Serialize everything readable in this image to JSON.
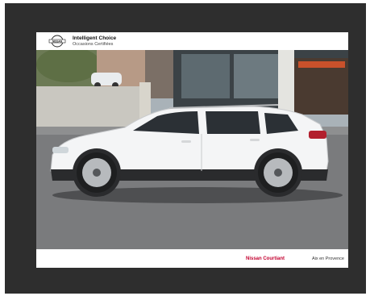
{
  "brand": {
    "logo_text": "NISSAN",
    "title": "Intelligent Choice",
    "subtitle": "Occasions Certifiées"
  },
  "photo": {
    "subject": "white-suv-side-view"
  },
  "footer": {
    "dealer": "Nissan Courtiant",
    "city": "Aix en Provence"
  },
  "colors": {
    "frame": "#2e2e2e",
    "accent": "#c3002f",
    "car": "#f4f5f6"
  }
}
